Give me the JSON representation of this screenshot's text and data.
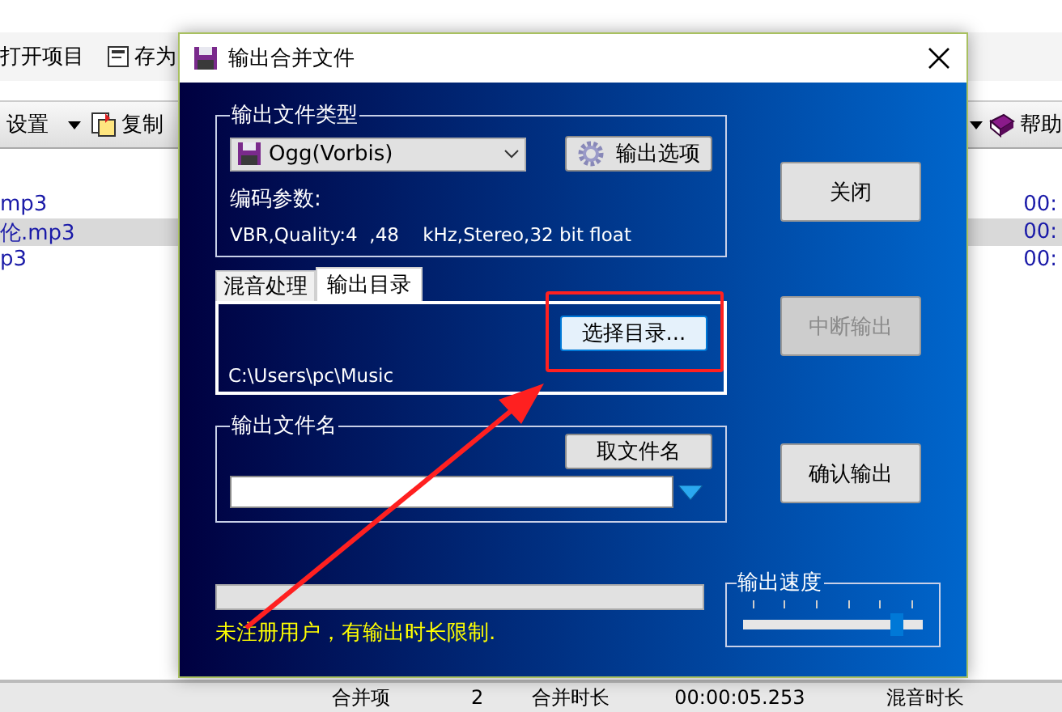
{
  "background_app": {
    "toolbar": [
      {
        "label": "打开项目"
      },
      {
        "label": "存为"
      }
    ],
    "toolbar_2": {
      "settings": "设置",
      "copy": "复制",
      "help": "帮助"
    },
    "list_rows": [
      {
        "name": "mp3",
        "time": "00:",
        "selected": false
      },
      {
        "name": "伦.mp3",
        "time": "00:",
        "selected": true
      },
      {
        "name": "p3",
        "time": "00:",
        "selected": false
      }
    ],
    "status_bar": [
      "合并项",
      "2",
      "合并时长",
      "00:00:05.253",
      "混音时长"
    ]
  },
  "dialog": {
    "title": "输出合并文件",
    "file_type": {
      "legend": "输出文件类型",
      "format": "Ogg(Vorbis)",
      "options_button": "输出选项",
      "params_label": "编码参数:",
      "params": "VBR,Quality:4  ,48    kHz,Stereo,32 bit float"
    },
    "tabs": [
      {
        "label": "混音处理",
        "selected": false
      },
      {
        "label": "输出目录",
        "selected": true
      }
    ],
    "output_dir": {
      "choose_button": "选择目录...",
      "path": "C:\\Users\\pc\\Music"
    },
    "file_name": {
      "legend": "输出文件名",
      "get_name_button": "取文件名"
    },
    "buttons": [
      {
        "label": "关闭",
        "disabled": false
      },
      {
        "label": "中断输出",
        "disabled": true
      },
      {
        "label": "确认输出",
        "disabled": false
      }
    ],
    "progress": {
      "level": 0
    },
    "warning": "未注册用户，有输出时长限制.",
    "speed": {
      "legend": "输出速度",
      "level": 0.86
    }
  }
}
